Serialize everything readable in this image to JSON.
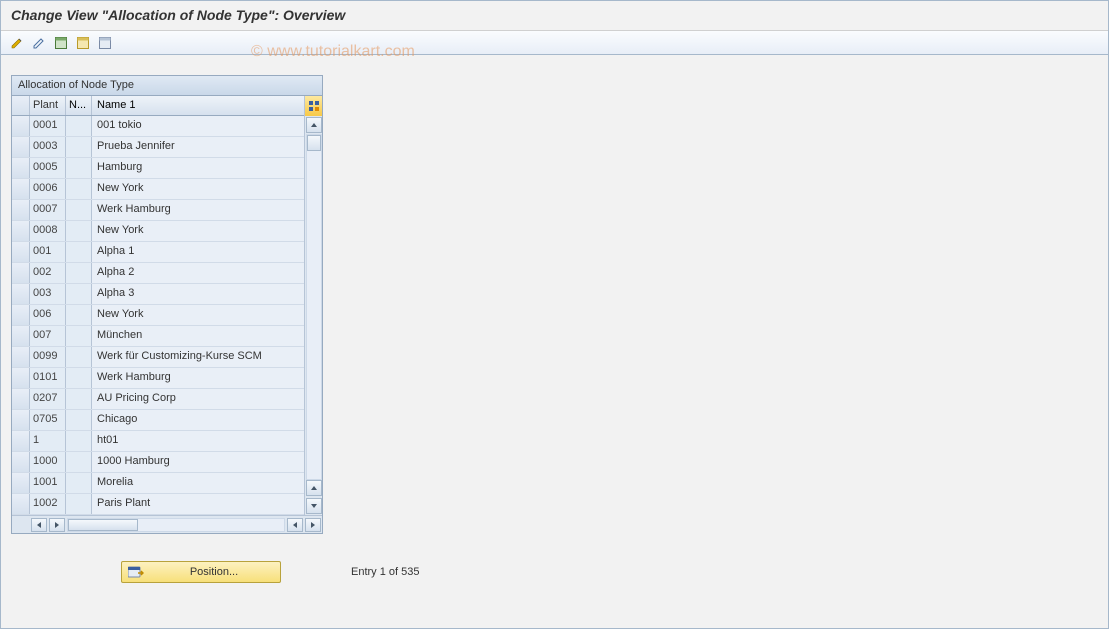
{
  "title": "Change View \"Allocation of Node Type\": Overview",
  "watermark": "© www.tutorialkart.com",
  "panel": {
    "header": "Allocation of Node Type",
    "columns": {
      "plant": "Plant",
      "n": "N...",
      "name": "Name 1"
    },
    "rows": [
      {
        "plant": "0001",
        "n": "",
        "name": "001 tokio"
      },
      {
        "plant": "0003",
        "n": "",
        "name": "Prueba Jennifer"
      },
      {
        "plant": "0005",
        "n": "",
        "name": "Hamburg"
      },
      {
        "plant": "0006",
        "n": "",
        "name": "New York"
      },
      {
        "plant": "0007",
        "n": "",
        "name": "Werk Hamburg"
      },
      {
        "plant": "0008",
        "n": "",
        "name": "New York"
      },
      {
        "plant": "001",
        "n": "",
        "name": "Alpha 1"
      },
      {
        "plant": "002",
        "n": "",
        "name": "Alpha 2"
      },
      {
        "plant": "003",
        "n": "",
        "name": "Alpha 3"
      },
      {
        "plant": "006",
        "n": "",
        "name": "New York"
      },
      {
        "plant": "007",
        "n": "",
        "name": "München"
      },
      {
        "plant": "0099",
        "n": "",
        "name": "Werk für Customizing-Kurse SCM"
      },
      {
        "plant": "0101",
        "n": "",
        "name": "Werk Hamburg"
      },
      {
        "plant": "0207",
        "n": "",
        "name": "AU Pricing Corp"
      },
      {
        "plant": "0705",
        "n": "",
        "name": "Chicago"
      },
      {
        "plant": "1",
        "n": "",
        "name": "ht01"
      },
      {
        "plant": "1000",
        "n": "",
        "name": "1000 Hamburg"
      },
      {
        "plant": "1001",
        "n": "",
        "name": "Morelia"
      },
      {
        "plant": "1002",
        "n": "",
        "name": "Paris Plant"
      }
    ]
  },
  "footer": {
    "position_label": "Position...",
    "entry_text": "Entry 1 of 535"
  },
  "icons": {
    "toolbar": [
      "change-other-view",
      "change",
      "select-all",
      "select-block",
      "deselect-all"
    ]
  }
}
